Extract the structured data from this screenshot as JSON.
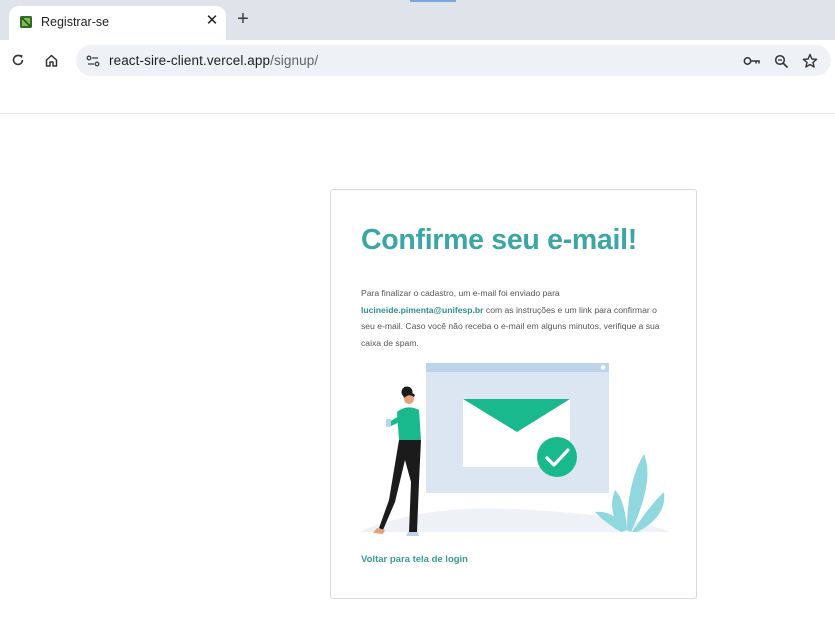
{
  "browser": {
    "tab": {
      "title": "Registrar-se",
      "close_glyph": "✕",
      "favicon": "app-favicon-icon"
    },
    "new_tab_glyph": "+",
    "url": {
      "host": "react-sire-client.vercel.app",
      "path": "/signup/"
    },
    "icons": [
      "reload-icon",
      "home-icon",
      "site-info-icon",
      "password-key-icon",
      "zoom-icon",
      "bookmark-star-icon"
    ]
  },
  "card": {
    "title": "Confirme seu e-mail!",
    "message": {
      "before_email": "Para finalizar o cadastro, um e-mail foi enviado para",
      "email": "lucineide.pimenta@unifesp.br",
      "after_email": "com as instruções e um link para confirmar o seu e-mail. Caso você não receba o e-mail em alguns minutos, verifique a sua caixa de spam."
    },
    "back_link": "Voltar para tela de login",
    "illustration": "email-sent-illustration"
  },
  "colors": {
    "accent": "#3ba6a5",
    "envelope": "#19b98d",
    "tabstrip": "#dfe3ea"
  }
}
